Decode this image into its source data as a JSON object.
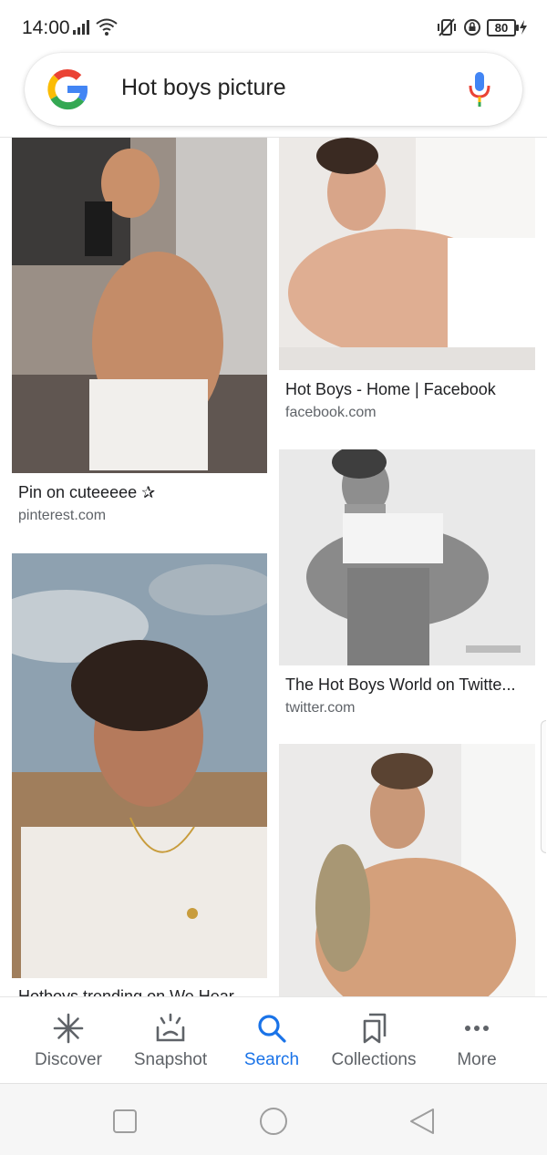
{
  "status_bar": {
    "time": "14:00",
    "battery": "80"
  },
  "search": {
    "query": "Hot boys picture"
  },
  "results": [
    {
      "title": "Pin on cuteeeee ✰",
      "source": "pinterest.com"
    },
    {
      "title": "Hot Boys - Home | Facebook",
      "source": "facebook.com"
    },
    {
      "title": "The Hot Boys World on Twitte...",
      "source": "twitter.com"
    },
    {
      "title": "Hotboys trending on We Hear",
      "source": ""
    },
    {
      "title": "",
      "source": ""
    }
  ],
  "bottom_nav": [
    {
      "label": "Discover",
      "icon": "asterisk-icon"
    },
    {
      "label": "Snapshot",
      "icon": "snapshot-icon"
    },
    {
      "label": "Search",
      "icon": "search-icon",
      "active": true
    },
    {
      "label": "Collections",
      "icon": "collections-icon"
    },
    {
      "label": "More",
      "icon": "more-dots-icon"
    }
  ],
  "colors": {
    "accent": "#1a73e8",
    "google_blue": "#4285f4",
    "google_red": "#ea4335",
    "google_yellow": "#fbbc05",
    "google_green": "#34a853"
  }
}
